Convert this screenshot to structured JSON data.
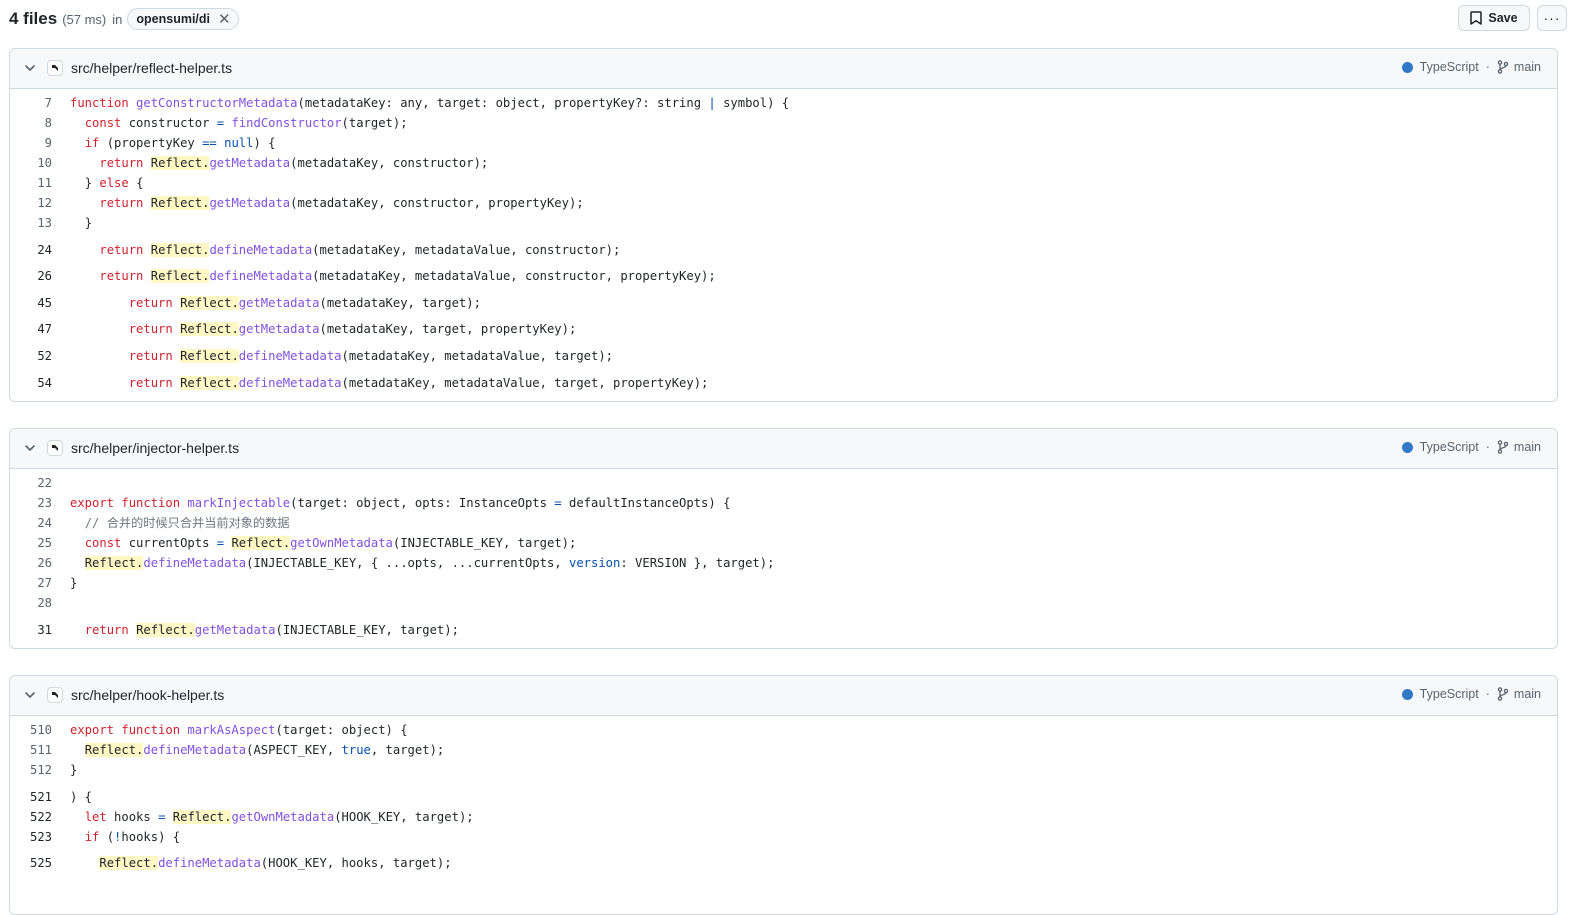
{
  "summary": {
    "count": "4 files",
    "time": "(57 ms)",
    "in": "in",
    "repo": "opensumi/di"
  },
  "actions": {
    "save": "Save"
  },
  "results": [
    {
      "path": "src/helper/reflect-helper.ts",
      "language": "TypeScript",
      "branch": "main",
      "lines": [
        {
          "n": "7",
          "indent": 0,
          "bold": false,
          "gap": false,
          "tokens": [
            [
              "k",
              "function "
            ],
            [
              "f",
              "getConstructorMetadata"
            ],
            [
              "t",
              "(metadataKey: any, target: object, propertyKey?: string "
            ],
            [
              "c",
              "|"
            ],
            [
              "t",
              " symbol) {"
            ]
          ]
        },
        {
          "n": "8",
          "indent": 2,
          "bold": false,
          "gap": false,
          "tokens": [
            [
              "k",
              "const "
            ],
            [
              "t",
              "constructor "
            ],
            [
              "c",
              "= "
            ],
            [
              "f",
              "findConstructor"
            ],
            [
              "t",
              "(target);"
            ]
          ]
        },
        {
          "n": "9",
          "indent": 2,
          "bold": false,
          "gap": false,
          "tokens": [
            [
              "k",
              "if "
            ],
            [
              "t",
              "(propertyKey "
            ],
            [
              "c",
              "== null"
            ],
            [
              "t",
              ") {"
            ]
          ]
        },
        {
          "n": "10",
          "indent": 4,
          "bold": false,
          "gap": false,
          "tokens": [
            [
              "k",
              "return "
            ],
            [
              "h",
              "Reflect."
            ],
            [
              "f",
              "getMetadata"
            ],
            [
              "t",
              "(metadataKey, constructor);"
            ]
          ]
        },
        {
          "n": "11",
          "indent": 2,
          "bold": false,
          "gap": false,
          "tokens": [
            [
              "t",
              "} "
            ],
            [
              "k",
              "else "
            ],
            [
              "t",
              "{"
            ]
          ]
        },
        {
          "n": "12",
          "indent": 4,
          "bold": false,
          "gap": false,
          "tokens": [
            [
              "k",
              "return "
            ],
            [
              "h",
              "Reflect."
            ],
            [
              "f",
              "getMetadata"
            ],
            [
              "t",
              "(metadataKey, constructor, propertyKey);"
            ]
          ]
        },
        {
          "n": "13",
          "indent": 2,
          "bold": false,
          "gap": false,
          "tokens": [
            [
              "t",
              "}"
            ]
          ]
        },
        {
          "n": "24",
          "indent": 4,
          "bold": true,
          "gap": true,
          "tokens": [
            [
              "k",
              "return "
            ],
            [
              "h",
              "Reflect."
            ],
            [
              "f",
              "defineMetadata"
            ],
            [
              "t",
              "(metadataKey, metadataValue, constructor);"
            ]
          ]
        },
        {
          "n": "26",
          "indent": 4,
          "bold": true,
          "gap": true,
          "tokens": [
            [
              "k",
              "return "
            ],
            [
              "h",
              "Reflect."
            ],
            [
              "f",
              "defineMetadata"
            ],
            [
              "t",
              "(metadataKey, metadataValue, constructor, propertyKey);"
            ]
          ]
        },
        {
          "n": "45",
          "indent": 8,
          "bold": true,
          "gap": true,
          "tokens": [
            [
              "k",
              "return "
            ],
            [
              "h",
              "Reflect."
            ],
            [
              "f",
              "getMetadata"
            ],
            [
              "t",
              "(metadataKey, target);"
            ]
          ]
        },
        {
          "n": "47",
          "indent": 8,
          "bold": true,
          "gap": true,
          "tokens": [
            [
              "k",
              "return "
            ],
            [
              "h",
              "Reflect."
            ],
            [
              "f",
              "getMetadata"
            ],
            [
              "t",
              "(metadataKey, target, propertyKey);"
            ]
          ]
        },
        {
          "n": "52",
          "indent": 8,
          "bold": true,
          "gap": true,
          "tokens": [
            [
              "k",
              "return "
            ],
            [
              "h",
              "Reflect."
            ],
            [
              "f",
              "defineMetadata"
            ],
            [
              "t",
              "(metadataKey, metadataValue, target);"
            ]
          ]
        },
        {
          "n": "54",
          "indent": 8,
          "bold": true,
          "gap": true,
          "tokens": [
            [
              "k",
              "return "
            ],
            [
              "h",
              "Reflect."
            ],
            [
              "f",
              "defineMetadata"
            ],
            [
              "t",
              "(metadataKey, metadataValue, target, propertyKey);"
            ]
          ]
        }
      ]
    },
    {
      "path": "src/helper/injector-helper.ts",
      "language": "TypeScript",
      "branch": "main",
      "lines": [
        {
          "n": "22",
          "indent": 0,
          "bold": false,
          "gap": false,
          "tokens": []
        },
        {
          "n": "23",
          "indent": 0,
          "bold": false,
          "gap": false,
          "tokens": [
            [
              "k",
              "export function "
            ],
            [
              "f",
              "markInjectable"
            ],
            [
              "t",
              "(target: object, opts: InstanceOpts "
            ],
            [
              "c",
              "="
            ],
            [
              "t",
              " defaultInstanceOpts) {"
            ]
          ]
        },
        {
          "n": "24",
          "indent": 2,
          "bold": false,
          "gap": false,
          "tokens": [
            [
              "m",
              "// 合并的时候只合并当前对象的数据"
            ]
          ]
        },
        {
          "n": "25",
          "indent": 2,
          "bold": false,
          "gap": false,
          "tokens": [
            [
              "k",
              "const "
            ],
            [
              "t",
              "currentOpts "
            ],
            [
              "c",
              "= "
            ],
            [
              "h",
              "Reflect."
            ],
            [
              "f",
              "getOwnMetadata"
            ],
            [
              "t",
              "(INJECTABLE_KEY, target);"
            ]
          ]
        },
        {
          "n": "26",
          "indent": 2,
          "bold": false,
          "gap": false,
          "tokens": [
            [
              "h",
              "Reflect."
            ],
            [
              "f",
              "defineMetadata"
            ],
            [
              "t",
              "(INJECTABLE_KEY, { ...opts, ...currentOpts, "
            ],
            [
              "c",
              "version"
            ],
            [
              "t",
              ": VERSION }, target);"
            ]
          ]
        },
        {
          "n": "27",
          "indent": 0,
          "bold": false,
          "gap": false,
          "tokens": [
            [
              "t",
              "}"
            ]
          ]
        },
        {
          "n": "28",
          "indent": 0,
          "bold": false,
          "gap": false,
          "tokens": []
        },
        {
          "n": "31",
          "indent": 2,
          "bold": true,
          "gap": true,
          "tokens": [
            [
              "k",
              "return "
            ],
            [
              "h",
              "Reflect."
            ],
            [
              "f",
              "getMetadata"
            ],
            [
              "t",
              "(INJECTABLE_KEY, target);"
            ]
          ]
        }
      ]
    },
    {
      "path": "src/helper/hook-helper.ts",
      "language": "TypeScript",
      "branch": "main",
      "lines": [
        {
          "n": "510",
          "indent": 0,
          "bold": false,
          "gap": false,
          "tokens": [
            [
              "k",
              "export function "
            ],
            [
              "f",
              "markAsAspect"
            ],
            [
              "t",
              "(target: object) {"
            ]
          ]
        },
        {
          "n": "511",
          "indent": 2,
          "bold": false,
          "gap": false,
          "tokens": [
            [
              "h",
              "Reflect."
            ],
            [
              "f",
              "defineMetadata"
            ],
            [
              "t",
              "(ASPECT_KEY, "
            ],
            [
              "c",
              "true"
            ],
            [
              "t",
              ", target);"
            ]
          ]
        },
        {
          "n": "512",
          "indent": 0,
          "bold": false,
          "gap": false,
          "tokens": [
            [
              "t",
              "}"
            ]
          ]
        },
        {
          "n": "521",
          "indent": 0,
          "bold": true,
          "gap": true,
          "tokens": [
            [
              "t",
              ") {"
            ]
          ]
        },
        {
          "n": "522",
          "indent": 2,
          "bold": true,
          "gap": false,
          "tokens": [
            [
              "k",
              "let "
            ],
            [
              "t",
              "hooks "
            ],
            [
              "c",
              "= "
            ],
            [
              "h",
              "Reflect."
            ],
            [
              "f",
              "getOwnMetadata"
            ],
            [
              "t",
              "(HOOK_KEY, target);"
            ]
          ]
        },
        {
          "n": "523",
          "indent": 2,
          "bold": true,
          "gap": false,
          "tokens": [
            [
              "k",
              "if "
            ],
            [
              "t",
              "("
            ],
            [
              "c",
              "!"
            ],
            [
              "t",
              "hooks) {"
            ]
          ]
        },
        {
          "n": "525",
          "indent": 4,
          "bold": true,
          "gap": true,
          "tokens": [
            [
              "h",
              "Reflect."
            ],
            [
              "f",
              "defineMetadata"
            ],
            [
              "t",
              "(HOOK_KEY, hooks, target);"
            ]
          ]
        }
      ]
    }
  ]
}
